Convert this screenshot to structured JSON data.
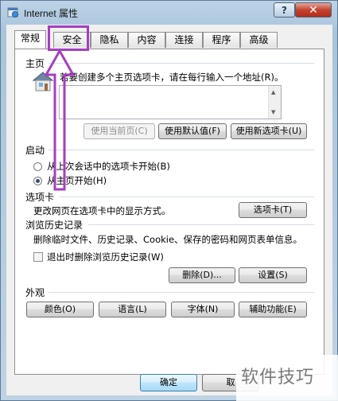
{
  "window": {
    "title": "Internet 属性",
    "help": "?",
    "close": "✕"
  },
  "tabs": [
    {
      "label": "常规",
      "active": true
    },
    {
      "label": "安全"
    },
    {
      "label": "隐私"
    },
    {
      "label": "内容"
    },
    {
      "label": "连接"
    },
    {
      "label": "程序"
    },
    {
      "label": "高级"
    }
  ],
  "home": {
    "group": "主页",
    "description": "若要创建多个主页选项卡，请在每行输入一个地址(R)。",
    "url_value": "",
    "use_current": "使用当前页(C)",
    "use_default": "使用默认值(F)",
    "use_new_tab": "使用新选项卡(U)"
  },
  "startup": {
    "group": "启动",
    "option_last_session": "从上次会话中的选项卡开始(B)",
    "option_home": "从主页开始(H)"
  },
  "tabs_section": {
    "group": "选项卡",
    "description": "更改网页在选项卡中的显示方式。",
    "button": "选项卡(T)"
  },
  "history": {
    "group": "浏览历史记录",
    "description": "删除临时文件、历史记录、Cookie、保存的密码和网页表单信息。",
    "checkbox": "退出时删除浏览历史记录(W)",
    "delete": "删除(D)...",
    "settings": "设置(S)"
  },
  "appearance": {
    "group": "外观",
    "colors": "颜色(O)",
    "languages": "语言(L)",
    "fonts": "字体(N)",
    "accessibility": "辅助功能(E)"
  },
  "footer": {
    "ok": "确定",
    "cancel": "取"
  },
  "watermark": "软件技巧",
  "colors": {
    "highlight": "#a53fbf"
  }
}
